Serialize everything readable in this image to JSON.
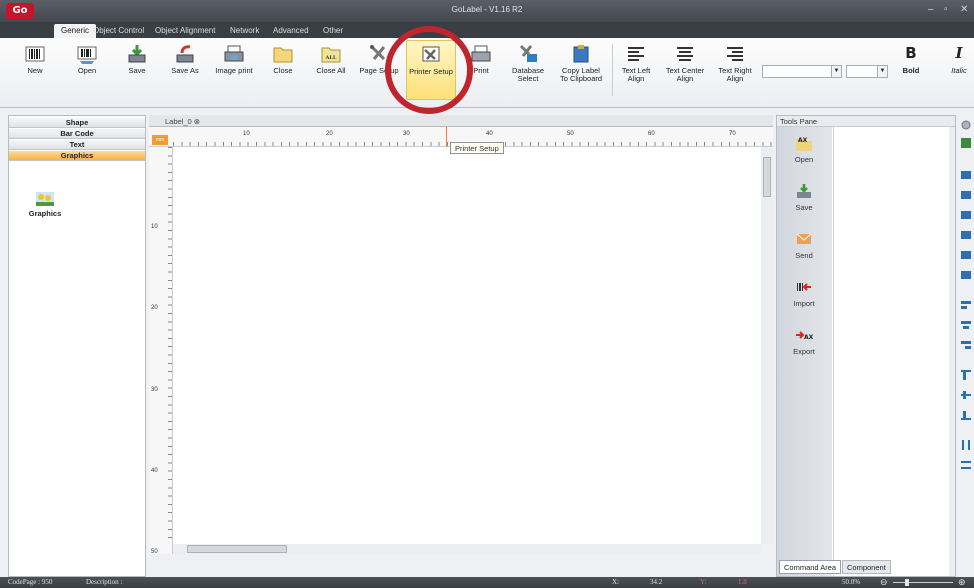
{
  "window": {
    "title": "GoLabel - V1.16 R2",
    "logo": "Go"
  },
  "tabs": [
    "Generic",
    "Object Control",
    "Object Alignment",
    "Network",
    "Advanced",
    "Other"
  ],
  "ribbon": {
    "new": "New",
    "open": "Open",
    "save": "Save",
    "save_as": "Save As",
    "image_print": "Image print",
    "close": "Close",
    "close_all": "Close All",
    "page_setup": "Page Setup",
    "printer_setup": "Printer Setup",
    "print": "Print",
    "database_select": "Database\nSelect",
    "copy_label": "Copy Label\nTo Clipboard",
    "text_left": "Text Left\nAlign",
    "text_center": "Text Center\nAlign",
    "text_right": "Text Right\nAlign",
    "bold": "Bold",
    "italic": "Italic",
    "bold_glyph": "B",
    "italic_glyph": "I",
    "closeall_badge": "ALL"
  },
  "left_panel": {
    "categories": [
      "Shape",
      "Bar Code",
      "Text",
      "Graphics"
    ],
    "active_category": "Graphics",
    "graphics_item": "Graphics"
  },
  "document": {
    "tab": "Label_0",
    "tooltip": "Printer Setup",
    "unit_badge": "mm"
  },
  "ruler": {
    "h_labels": [
      "10",
      "20",
      "30",
      "40",
      "50",
      "60",
      "70"
    ],
    "v_labels": [
      "10",
      "20",
      "30",
      "40",
      "50"
    ]
  },
  "tools_pane": {
    "title": "Tools Pane",
    "buttons": [
      "Open",
      "Save",
      "Send",
      "Import",
      "Export"
    ],
    "command_area": "Command Area",
    "component": "Component"
  },
  "status": {
    "codepage": "CodePage : 950",
    "description": "Description :",
    "x_label": "X:",
    "x_value": "34.2",
    "y_label": "Y:",
    "y_value": "1.8",
    "zoom": "50.0%"
  },
  "colors": {
    "accent": "#f7b34a",
    "highlight": "#ffe17a",
    "ring": "#c0242c",
    "logo": "#c8142a"
  }
}
